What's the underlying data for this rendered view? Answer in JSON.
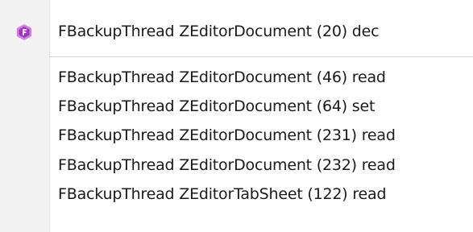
{
  "menu": {
    "items": [
      {
        "label": "FBackupThread ZEditorDocument (20) dec",
        "icon": "purple-hexagon-f-icon"
      },
      {
        "label": "FBackupThread ZEditorDocument (46) read"
      },
      {
        "label": "FBackupThread ZEditorDocument (64) set"
      },
      {
        "label": "FBackupThread ZEditorDocument (231) read"
      },
      {
        "label": "FBackupThread ZEditorDocument (232) read"
      },
      {
        "label": "FBackupThread ZEditorTabSheet (122) read"
      }
    ],
    "icon_colors": {
      "outer": "#d47fe6",
      "inner": "#a532c8",
      "glyph": "#ffffff"
    }
  }
}
